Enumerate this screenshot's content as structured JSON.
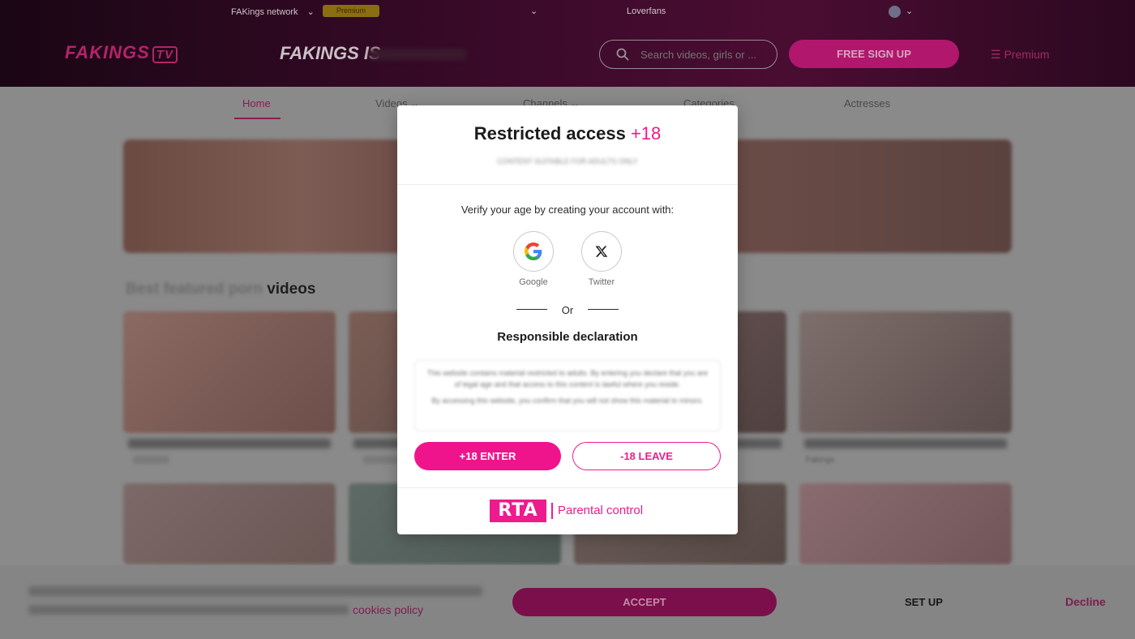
{
  "header": {
    "network_label": "FAKings network",
    "network_badge": "Premium",
    "partner_link": "Loverfans",
    "logo": "FAKINGS TV",
    "slogan": "FAKINGS IS",
    "search": {
      "placeholder": "Search videos, girls or ..."
    },
    "signup_label": "FREE SIGN UP",
    "premium_label": "Premium"
  },
  "nav": {
    "items": [
      {
        "label": "Home"
      },
      {
        "label": "Videos"
      },
      {
        "label": "Channels"
      },
      {
        "label": "Categories"
      },
      {
        "label": "Actresses"
      }
    ]
  },
  "main": {
    "section_title": "videos",
    "card_tag": "Fakings"
  },
  "modal": {
    "title": "Restricted access ",
    "title_accent": "+18",
    "subtitle": "CONTENT SUITABLE FOR ADULTS ONLY",
    "verify_text": "Verify your age by creating your account with:",
    "social": [
      {
        "label": "Google",
        "icon": "google-icon"
      },
      {
        "label": "Twitter",
        "icon": "x-icon"
      }
    ],
    "or_text": "Or",
    "declaration_title": "Responsible declaration",
    "enter_label": "+18 ENTER",
    "leave_label": "-18 LEAVE",
    "rta_label": "RTA",
    "parental_label": "Parental control"
  },
  "cookies": {
    "policy_link": "cookies policy",
    "accept_label": "ACCEPT",
    "setup_label": "SET UP",
    "decline_label": "Decline"
  },
  "colors": {
    "accent": "#ec1c8c",
    "header_bg": "#3b0a2a"
  }
}
